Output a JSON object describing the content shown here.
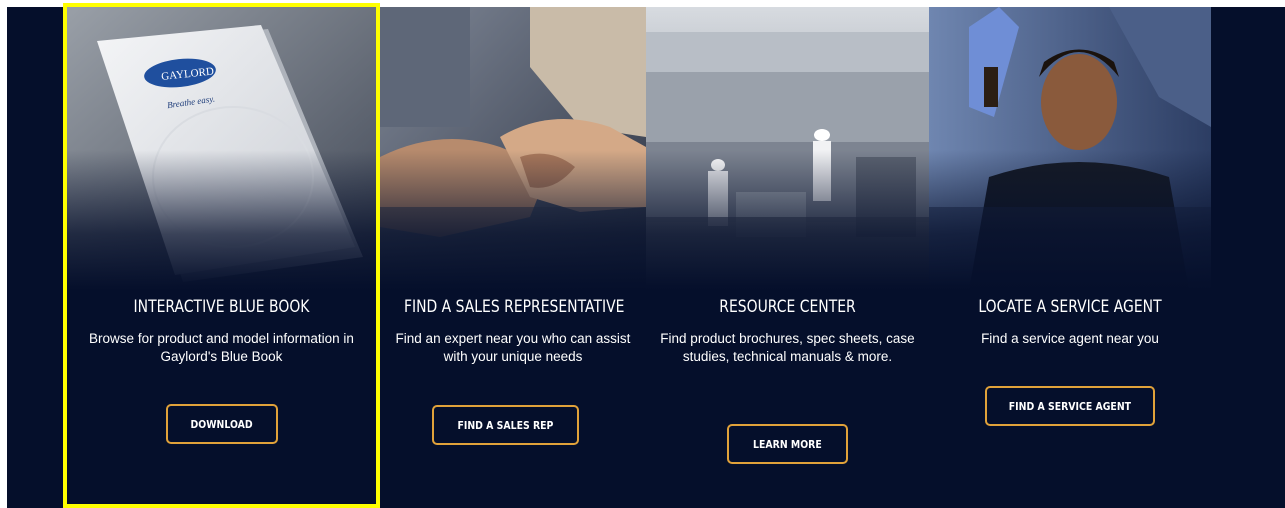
{
  "cards": [
    {
      "title": "INTERACTIVE BLUE BOOK",
      "description": "Browse for product and model information in Gaylord's Blue Book",
      "button": "DOWNLOAD",
      "image": {
        "logo_text": "GAYLORD",
        "tagline": "Breathe easy."
      }
    },
    {
      "title": "FIND A SALES REPRESENTATIVE",
      "description": "Find an expert near you who can assist with your unique needs",
      "button": "FIND A SALES REP"
    },
    {
      "title": "RESOURCE CENTER",
      "description": "Find product brochures, spec sheets, case studies, technical manuals & more.",
      "button": "LEARN MORE"
    },
    {
      "title": "LOCATE A SERVICE AGENT",
      "description": "Find a service agent near you",
      "button": "FIND A SERVICE AGENT"
    }
  ],
  "colors": {
    "background": "#050f2b",
    "button_border": "#e1a23a",
    "highlight": "#ffff00"
  },
  "icons": [
    "blue-book-photo",
    "handshake-photo",
    "kitchen-photo",
    "service-technician-photo"
  ]
}
